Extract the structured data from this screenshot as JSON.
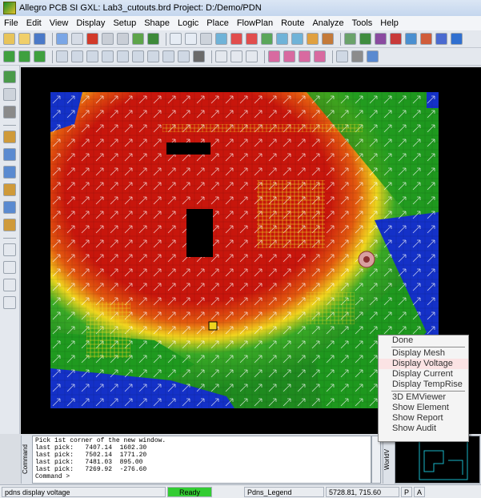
{
  "window": {
    "title": "Allegro PCB SI GXL: Lab3_cutouts.brd  Project: D:/Demo/PDN"
  },
  "menu": [
    "File",
    "Edit",
    "View",
    "Display",
    "Setup",
    "Shape",
    "Logic",
    "Place",
    "FlowPlan",
    "Route",
    "Analyze",
    "Tools",
    "Help"
  ],
  "context_menu": {
    "items_top": [
      "Done"
    ],
    "items_display": [
      "Display Mesh",
      "Display Voltage",
      "Display Current",
      "Display TempRise"
    ],
    "items_tools": [
      "3D EMViewer",
      "Show Element",
      "Show Report",
      "Show Audit"
    ],
    "highlighted": "Display Voltage"
  },
  "command_window": {
    "label": "Command",
    "lines": [
      "Pick 1st corner of the new window.",
      "last pick:   7407.14  1602.30",
      "last pick:   7502.14  1771.20",
      "last pick:   7481.03  895.00",
      "last pick:   7269.92  -276.60",
      "Command >"
    ]
  },
  "world_view": {
    "label": "WorldV"
  },
  "status": {
    "command": "pdns display voltage",
    "state": "Ready",
    "state_color": "#33cc33",
    "mode": "Pdns_Legend",
    "coords": "5728.81, 715.60",
    "p_label": "P",
    "a_label": "A"
  },
  "colors": {
    "voltage_high": "#c8160c",
    "voltage_mid": "#f0d51e",
    "voltage_low_green": "#1f9a1f",
    "voltage_lowest": "#1431c8"
  }
}
